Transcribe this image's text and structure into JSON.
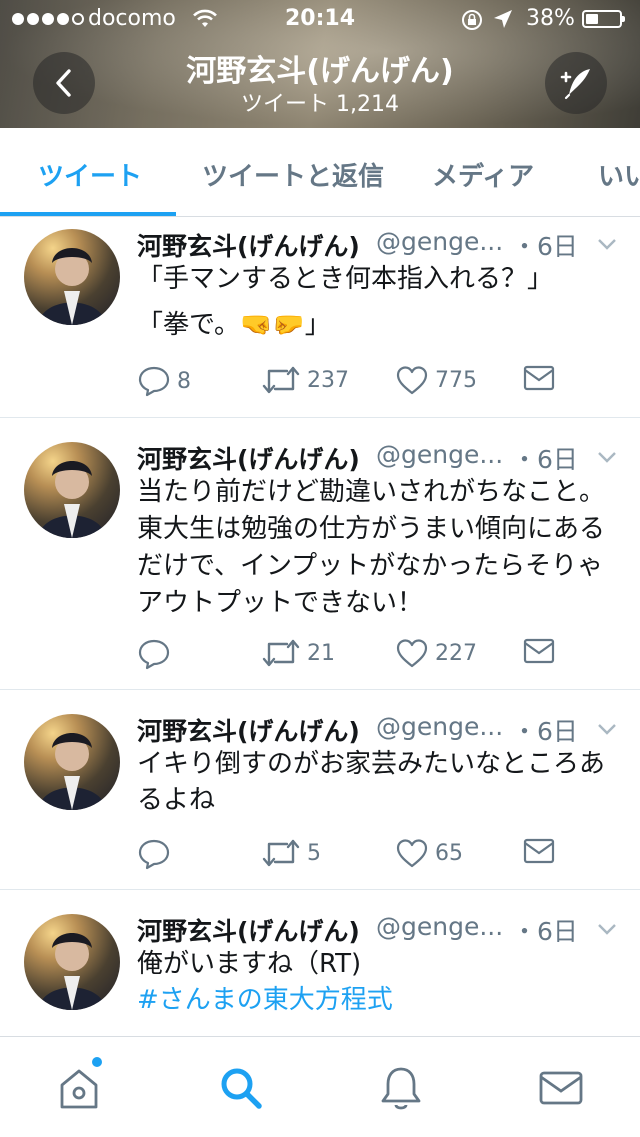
{
  "status_bar": {
    "carrier": "docomo",
    "time": "20:14",
    "battery_percent": "38%",
    "battery_level": 0.38
  },
  "header": {
    "title": "河野玄斗(げんげん)",
    "subtitle": "ツイート 1,214"
  },
  "tabs": [
    {
      "label": "ツイート",
      "active": true
    },
    {
      "label": "ツイートと返信",
      "active": false
    },
    {
      "label": "メディア",
      "active": false
    },
    {
      "label": "いい",
      "active": false
    }
  ],
  "tweets": [
    {
      "name": "河野玄斗(げんげん)",
      "handle": "@genge...",
      "time": "・6日",
      "lines": [
        "「手マンするとき何本指入れる？」",
        "「拳で。🤜🤛」"
      ],
      "replies": "8",
      "retweets": "237",
      "likes": "775"
    },
    {
      "name": "河野玄斗(げんげん)",
      "handle": "@genge...",
      "time": "・6日",
      "lines": [
        "当たり前だけど勘違いされがちなこと。東大生は勉強の仕方がうまい傾向にあるだけで、インプットがなかったらそりゃアウトプットできない！"
      ],
      "replies": "",
      "retweets": "21",
      "likes": "227"
    },
    {
      "name": "河野玄斗(げんげん)",
      "handle": "@genge...",
      "time": "・6日",
      "lines": [
        "イキり倒すのがお家芸みたいなところあるよね"
      ],
      "replies": "",
      "retweets": "5",
      "likes": "65"
    },
    {
      "name": "河野玄斗(げんげん)",
      "handle": "@genge...",
      "time": "・6日",
      "lines": [
        "俺がいますね（RT)"
      ],
      "hashtag": "#さんまの東大方程式"
    }
  ],
  "colors": {
    "accent": "#1da1f2",
    "text": "#14171a",
    "secondary": "#657786"
  },
  "icons": {
    "nav": [
      "home-icon",
      "search-icon",
      "notifications-icon",
      "messages-icon"
    ],
    "actions": [
      "reply-icon",
      "retweet-icon",
      "like-icon",
      "direct-message-icon"
    ]
  }
}
